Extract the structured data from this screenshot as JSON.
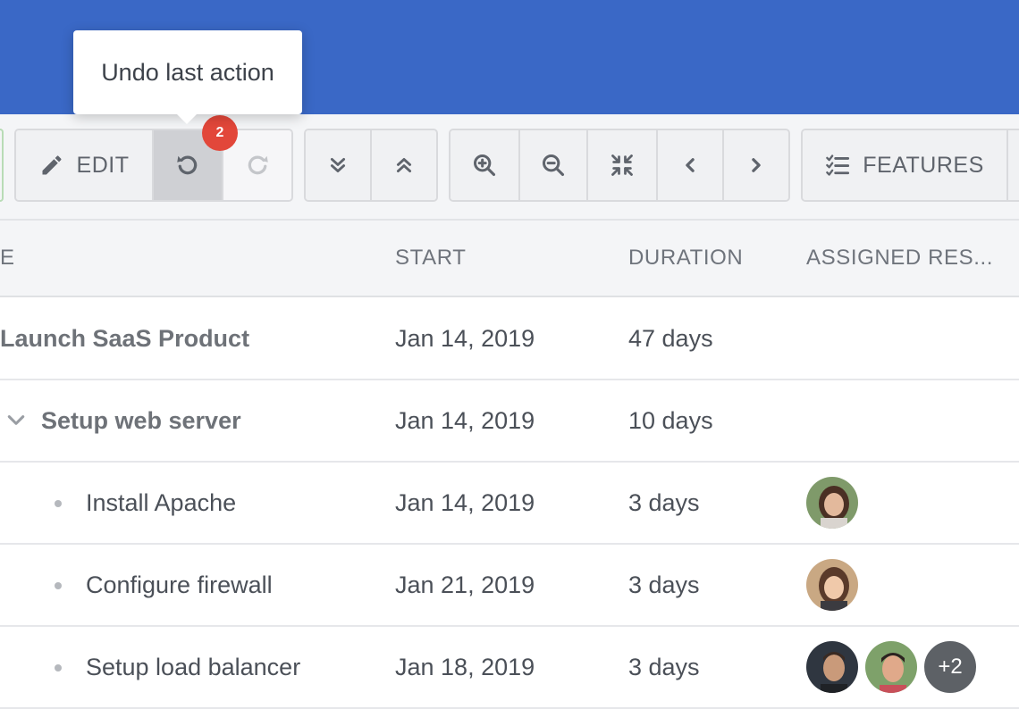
{
  "tooltip": {
    "text": "Undo last action"
  },
  "toolbar": {
    "edit_label": "EDIT",
    "undo_count": "2",
    "features_label": "FEATURES"
  },
  "columns": {
    "name": "E",
    "start": "START",
    "duration": "DURATION",
    "resources": "ASSIGNED RES..."
  },
  "rows": [
    {
      "name": "Launch SaaS Product",
      "start": "Jan 14, 2019",
      "duration": "47 days"
    },
    {
      "name": "Setup web server",
      "start": "Jan 14, 2019",
      "duration": "10 days"
    },
    {
      "name": "Install Apache",
      "start": "Jan 14, 2019",
      "duration": "3 days"
    },
    {
      "name": "Configure firewall",
      "start": "Jan 21, 2019",
      "duration": "3 days"
    },
    {
      "name": "Setup load balancer",
      "start": "Jan 18, 2019",
      "duration": "3 days",
      "extra_resources": "+2"
    }
  ],
  "colors": {
    "header": "#3a68c6",
    "badge": "#e2473a"
  }
}
